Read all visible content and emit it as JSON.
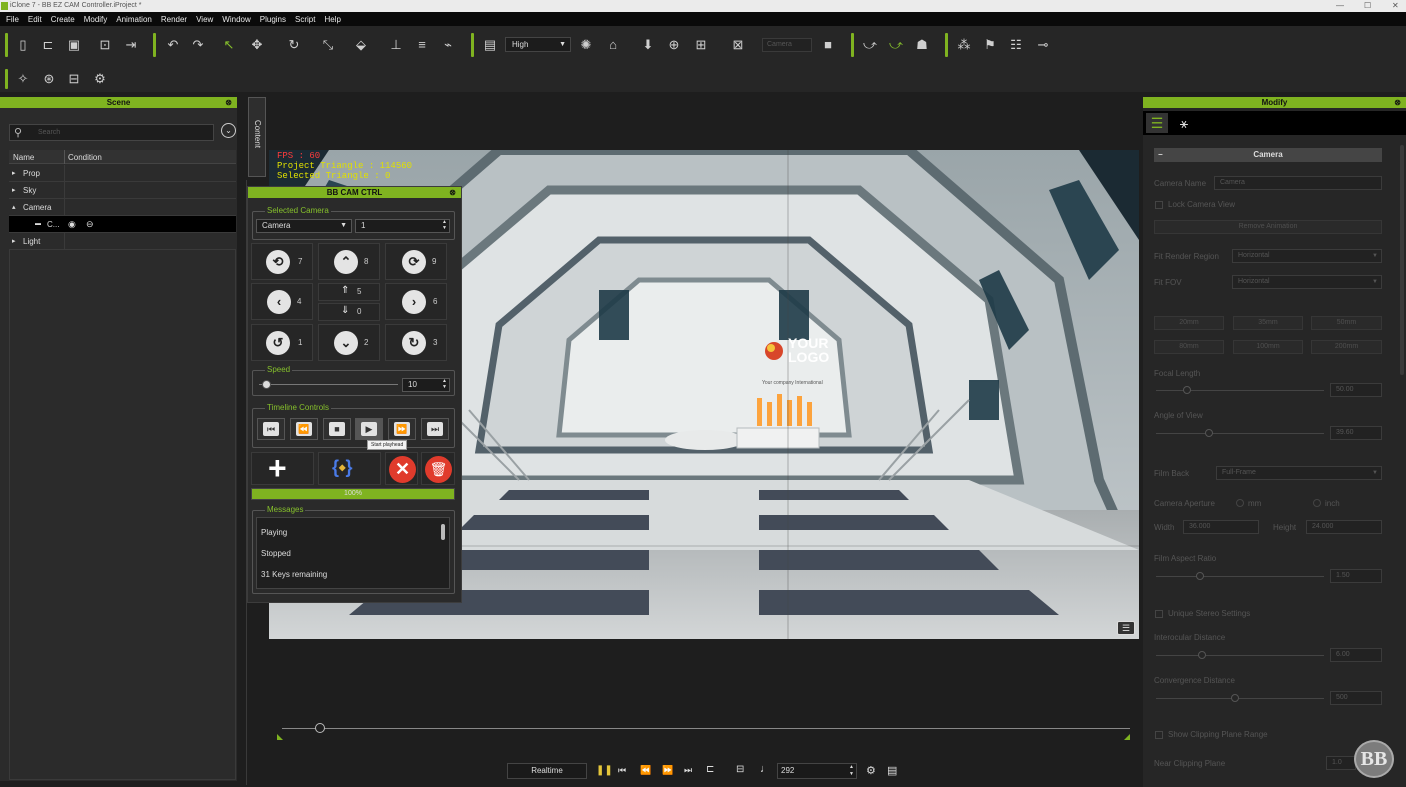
{
  "window": {
    "title": "iClone 7 - BB EZ CAM Controller.iProject *",
    "controls": [
      "—",
      "☐",
      "✕"
    ]
  },
  "menu": [
    "File",
    "Edit",
    "Create",
    "Modify",
    "Animation",
    "Render",
    "View",
    "Window",
    "Plugins",
    "Script",
    "Help"
  ],
  "toolbar": {
    "quality_value": "High",
    "camera_select": "Camera"
  },
  "scene_panel": {
    "title": "Scene",
    "search_placeholder": "Search",
    "columns": [
      "Name",
      "Condition"
    ],
    "items": [
      {
        "label": "Prop",
        "arrow": "▸"
      },
      {
        "label": "Sky",
        "arrow": "▸"
      },
      {
        "label": "Camera",
        "arrow": "▴"
      },
      {
        "label": "C...",
        "arrow": "▬"
      },
      {
        "label": "Light",
        "arrow": "▸"
      }
    ]
  },
  "content_tab": {
    "label": "Content"
  },
  "hud": {
    "fps": "FPS : 60",
    "project_triangle": "Project Triangle : 114560",
    "selected_triangle": "Selected Triangle : 0"
  },
  "viewport": {
    "logo_line1": "YOUR",
    "logo_line2": "LOGO",
    "logo_sub": "Your company International"
  },
  "bbcam": {
    "title": "BB CAM CTRL",
    "selected_camera_label": "Selected Camera",
    "camera_value": "Camera",
    "camera_index": "1",
    "pad_numbers": [
      "7",
      "8",
      "9",
      "4",
      "5",
      "0",
      "6",
      "1",
      "2",
      "3"
    ],
    "speed_label": "Speed",
    "speed_value": "10",
    "speed_level_percent": 5,
    "timeline_label": "Timeline Controls",
    "tooltip": "Start playhead",
    "progress_text": "100%",
    "progress_percent": 100,
    "messages_label": "Messages",
    "messages": [
      "Playing",
      "Stopped",
      "31 Keys remaining"
    ]
  },
  "modify_panel": {
    "title": "Modify",
    "section": "Camera",
    "camera_name_label": "Camera Name",
    "camera_name_value": "Camera",
    "lock_camera_view": "Lock Camera View",
    "remove_animation": "Remove Animation",
    "fit_render_region_label": "Fit Render Region",
    "fit_render_region_value": "Horizontal",
    "fit_fov_label": "Fit FOV",
    "fit_fov_value": "Horizontal",
    "lens_buttons": [
      "20mm",
      "35mm",
      "50mm",
      "80mm",
      "100mm",
      "200mm"
    ],
    "focal_length_label": "Focal Length",
    "focal_length_value": "50.00",
    "angle_of_view_label": "Angle of View",
    "angle_of_view_value": "39.60",
    "film_back_label": "Film Back",
    "film_back_value": "Full-Frame",
    "camera_aperture_label": "Camera Aperture",
    "aperture_units": [
      "mm",
      "inch"
    ],
    "width_label": "Width",
    "width_value": "36.000",
    "height_label": "Height",
    "height_value": "24.000",
    "film_aspect_label": "Film Aspect Ratio",
    "film_aspect_value": "1.50",
    "unique_stereo": "Unique Stereo Settings",
    "interocular_label": "Interocular Distance",
    "interocular_value": "6.00",
    "convergence_label": "Convergence Distance",
    "convergence_value": "500",
    "show_clipping": "Show Clipping Plane Range",
    "near_clipping_label": "Near Clipping Plane",
    "near_clipping_value": "1.0"
  },
  "playback": {
    "mode": "Realtime",
    "frame": "292"
  },
  "watermark": "BB",
  "colors": {
    "accent": "#7fb320",
    "hud_red": "#ff3b3b",
    "hud_yellow": "#e0e000"
  }
}
